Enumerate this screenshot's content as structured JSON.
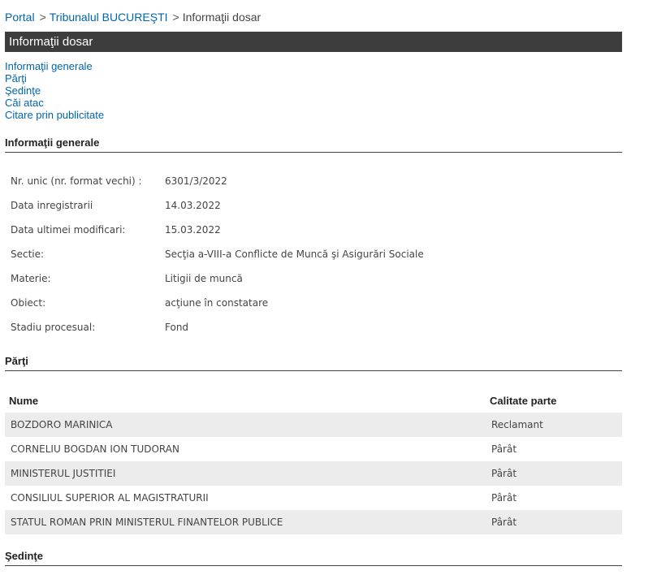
{
  "breadcrumb": {
    "items": [
      "Portal",
      "Tribunalul BUCUREŞTI",
      "Informaţii dosar"
    ],
    "separator": ">"
  },
  "title_bar": "Informaţii dosar",
  "nav": [
    "Informaţii generale",
    "Părţi",
    "Şedinţe",
    "Căi atac",
    "Citare prin publicitate"
  ],
  "general": {
    "heading": "Informaţii generale",
    "rows": [
      {
        "label": "Nr. unic (nr. format vechi) :",
        "value": "6301/3/2022"
      },
      {
        "label": "Data inregistrarii",
        "value": "14.03.2022"
      },
      {
        "label": "Data ultimei modificari:",
        "value": "15.03.2022"
      },
      {
        "label": "Sectie:",
        "value": "Secţia a-VIII-a Conflicte de Muncă şi Asigurări Sociale"
      },
      {
        "label": "Materie:",
        "value": "Litigii de muncă"
      },
      {
        "label": "Obiect:",
        "value": "acţiune în constatare"
      },
      {
        "label": "Stadiu procesual:",
        "value": "Fond"
      }
    ]
  },
  "parties": {
    "heading": "Părţi",
    "columns": [
      "Nume",
      "Calitate parte"
    ],
    "rows": [
      {
        "name": "BOZDORO MARINICA",
        "role": "Reclamant"
      },
      {
        "name": "CORNELIU BOGDAN ION TUDORAN",
        "role": "Pârât"
      },
      {
        "name": "MINISTERUL JUSTITIEI",
        "role": "Pârât"
      },
      {
        "name": "CONSILIUL SUPERIOR AL MAGISTRATURII",
        "role": "Pârât"
      },
      {
        "name": "STATUL ROMAN PRIN MINISTERUL FINANTELOR PUBLICE",
        "role": "Pârât"
      }
    ]
  },
  "hearings": {
    "heading": "Şedinţe"
  },
  "colors": {
    "link": "#0066aa",
    "title_bar_bg": "#3d3d3d",
    "row_alt_bg": "#ececec"
  }
}
